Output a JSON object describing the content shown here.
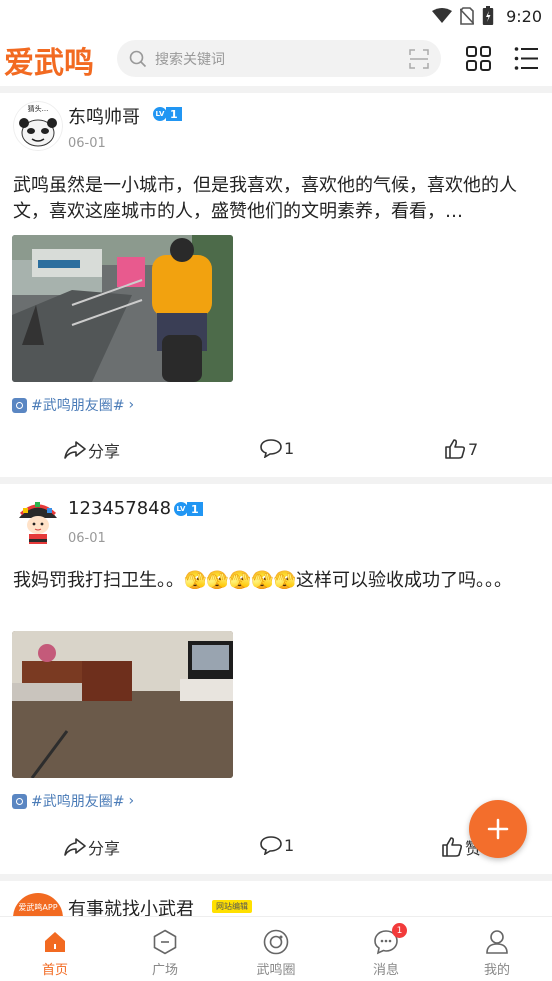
{
  "status_bar": {
    "time": "9:20",
    "icons": [
      "wifi-icon",
      "no-sim-icon",
      "battery-icon"
    ]
  },
  "header": {
    "logo": "爱武鸣",
    "search": {
      "placeholder": "搜索关键词",
      "icon": "search-icon",
      "scan_icon": "scan-icon"
    },
    "right_icons": [
      "grid-icon",
      "list-menu-icon"
    ]
  },
  "posts": [
    {
      "username": "东鸣帅哥",
      "level": "1",
      "level_icon": "LV",
      "date": "06-01",
      "text": "武鸣虽然是一小城市，但是我喜欢，喜欢他的气候，喜欢他的人文，喜欢这座城市的人，盛赞他们的文明素养，看看，…",
      "avatar_caption": "猜头...",
      "tag": "#武鸣朋友圈#",
      "share_label": "分享",
      "comment_count": "1",
      "like_count": "7"
    },
    {
      "username": "123457848",
      "level": "1",
      "level_icon": "LV",
      "date": "06-01",
      "text": "我妈罚我打扫卫生。。🫣🫣🫣🫣🫣这样可以验收成功了吗。。。",
      "tag": "#武鸣朋友圈#",
      "share_label": "分享",
      "comment_count": "1",
      "like_label": "赞"
    },
    {
      "username": "有事就找小武君",
      "badge": "网站编辑",
      "avatar_caption": "爱武鸣APP"
    }
  ],
  "fab": {
    "icon": "plus-icon"
  },
  "bottom_nav": [
    {
      "label": "首页",
      "icon": "home-icon",
      "active": true
    },
    {
      "label": "广场",
      "icon": "square-icon",
      "active": false
    },
    {
      "label": "武鸣圈",
      "icon": "circle-icon",
      "active": false
    },
    {
      "label": "消息",
      "icon": "message-icon",
      "active": false,
      "badge": "1"
    },
    {
      "label": "我的",
      "icon": "profile-icon",
      "active": false
    }
  ],
  "colors": {
    "brand": "#f26a21",
    "level_blue": "#2196f3",
    "tag_blue": "#4a7bb7",
    "badge_red": "#f23b3b"
  }
}
